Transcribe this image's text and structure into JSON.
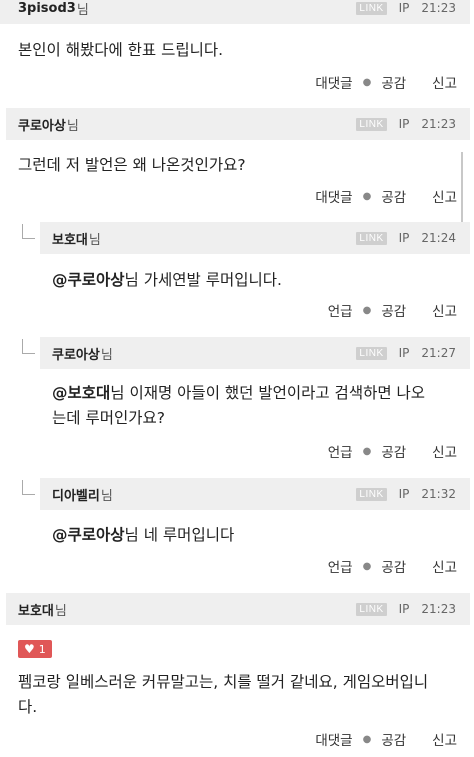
{
  "comments": [
    {
      "author": "3pisod3",
      "suffix": "님",
      "badge": "LINK",
      "ip": "IP",
      "time": "21:23",
      "text": "본인이 해봤다에 한표 드립니다.",
      "reply": "대댓글",
      "like": "공감",
      "report": "신고"
    },
    {
      "author": "쿠로아상",
      "suffix": "님",
      "badge": "LINK",
      "ip": "IP",
      "time": "21:23",
      "text": "그런데 저 발언은 왜 나온것인가요?",
      "reply": "대댓글",
      "like": "공감",
      "report": "신고"
    },
    {
      "author": "보호대",
      "suffix": "님",
      "badge": "LINK",
      "ip": "IP",
      "time": "21:24",
      "mention": "@쿠로아상",
      "text": "님 가세연발 루머입니다.",
      "reply": "언급",
      "like": "공감",
      "report": "신고"
    },
    {
      "author": "쿠로아상",
      "suffix": "님",
      "badge": "LINK",
      "ip": "IP",
      "time": "21:27",
      "mention": "@보호대",
      "text": "님 이재명 아들이 했던 발언이라고 검색하면 나오",
      "text2": "는데 루머인가요?",
      "reply": "언급",
      "like": "공감",
      "report": "신고"
    },
    {
      "author": "디아벨리",
      "suffix": "님",
      "badge": "LINK",
      "ip": "IP",
      "time": "21:32",
      "mention": "@쿠로아상",
      "text": "님 네 루머입니다",
      "reply": "언급",
      "like": "공감",
      "report": "신고"
    },
    {
      "author": "보호대",
      "suffix": "님",
      "badge": "LINK",
      "ip": "IP",
      "time": "21:23",
      "likes": "1",
      "text": "펨코랑 일베스러운 커뮤말고는, 치를 떨거 같네요, 게임오버입니",
      "text2": "다.",
      "reply": "대댓글",
      "like": "공감",
      "report": "신고"
    }
  ],
  "colors": {
    "header_bg": "#efefef",
    "like_badge": "#e05757"
  },
  "icons": {
    "heart": "heart-icon"
  }
}
